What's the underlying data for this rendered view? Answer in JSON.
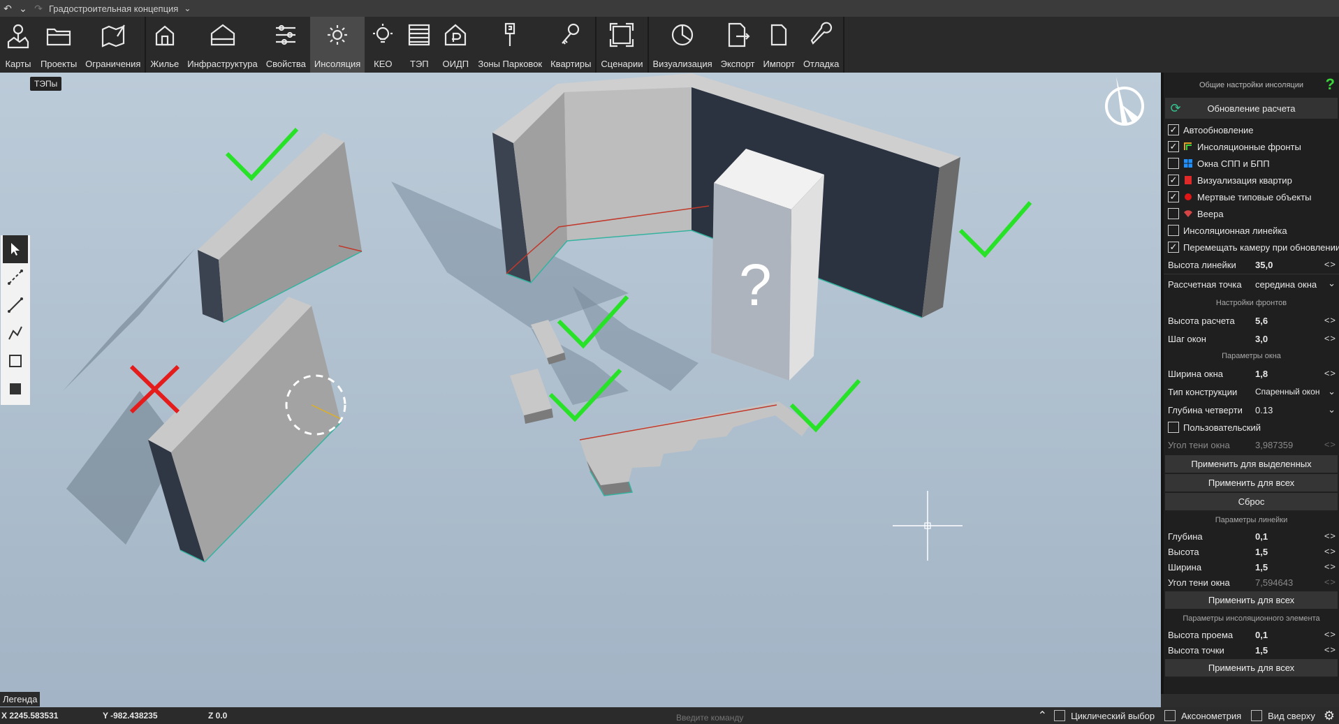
{
  "titlebar": {
    "document": "Градостроительная концепция"
  },
  "toolbar": {
    "groups": [
      [
        {
          "label": "Карты",
          "icon": "map-pin-icon"
        },
        {
          "label": "Проекты",
          "icon": "folder-icon"
        },
        {
          "label": "Ограничения",
          "icon": "map-edit-icon"
        }
      ],
      [
        {
          "label": "Жилье",
          "icon": "house-icon"
        },
        {
          "label": "Инфраструктура",
          "icon": "infrastructure-icon"
        },
        {
          "label": "Свойства",
          "icon": "sliders-icon"
        },
        {
          "label": "Инсоляция",
          "icon": "sun-icon",
          "active": true
        },
        {
          "label": "КЕО",
          "icon": "light-bulb-icon"
        },
        {
          "label": "ТЭП",
          "icon": "table-icon"
        },
        {
          "label": "ОИДП",
          "icon": "ruble-house-icon"
        },
        {
          "label": "Зоны Парковок",
          "icon": "parking-icon"
        },
        {
          "label": "Квартиры",
          "icon": "keys-icon"
        }
      ],
      [
        {
          "label": "Сценарии",
          "icon": "frame-icon"
        }
      ],
      [
        {
          "label": "Визуализация",
          "icon": "pie-icon"
        },
        {
          "label": "Экспорт",
          "icon": "export-icon"
        },
        {
          "label": "Импорт",
          "icon": "file-icon"
        },
        {
          "label": "Отладка",
          "icon": "wrench-icon"
        }
      ]
    ]
  },
  "viewport": {
    "tep_tag": "ТЭПы",
    "question_mark": "?",
    "legend": "Легенда"
  },
  "panel": {
    "header": "Общие настройки инсоляции",
    "help": "?",
    "update_button": "Обновление расчета",
    "checkboxes": [
      {
        "label": "Автообновление",
        "checked": true,
        "icon": ""
      },
      {
        "label": "Инсоляционные фронты",
        "checked": true,
        "icon": "fronts-icon"
      },
      {
        "label": "Окна СПП и БПП",
        "checked": false,
        "icon": "windows-icon"
      },
      {
        "label": "Визуализация квартир",
        "checked": true,
        "icon": "flag-icon"
      },
      {
        "label": "Мертвые типовые объекты",
        "checked": true,
        "icon": "red-dot-icon"
      },
      {
        "label": "Веера",
        "checked": false,
        "icon": "fan-icon"
      },
      {
        "label": "Инсоляционная линейка",
        "checked": false,
        "icon": ""
      },
      {
        "label": "Перемещать камеру при обновлении",
        "checked": true,
        "icon": ""
      }
    ],
    "ruler_height": {
      "label": "Высота линейки",
      "value": "35,0"
    },
    "calc_point": {
      "label": "Рассчетная точка",
      "value": "середина окна"
    },
    "fronts_section": "Настройки фронтов",
    "calc_height": {
      "label": "Высота расчета",
      "value": "5,6"
    },
    "window_step": {
      "label": "Шаг окон",
      "value": "3,0"
    },
    "window_section": "Параметры окна",
    "window_width": {
      "label": "Ширина окна",
      "value": "1,8"
    },
    "construction": {
      "label": "Тип конструкции",
      "value": "Спаренный окон"
    },
    "quarter_depth": {
      "label": "Глубина четверти",
      "value": "0.13"
    },
    "custom": {
      "label": "Пользовательский",
      "checked": false
    },
    "shadow_angle": {
      "label": "Угол тени окна",
      "value": "3,987359"
    },
    "apply_selected": "Применить для выделенных",
    "apply_all": "Применить для всех",
    "reset": "Сброс",
    "ruler_section": "Параметры линейки",
    "r_depth": {
      "label": "Глубина",
      "value": "0,1"
    },
    "r_height": {
      "label": "Высота",
      "value": "1,5"
    },
    "r_width": {
      "label": "Ширина",
      "value": "1,5"
    },
    "r_shadow": {
      "label": "Угол тени окна",
      "value": "7,594643"
    },
    "apply_all_2": "Применить для всех",
    "element_section": "Параметры инсоляционного элемента",
    "opening_height": {
      "label": "Высота проема",
      "value": "0,1"
    },
    "point_height": {
      "label": "Высота точки",
      "value": "1,5"
    },
    "apply_all_3": "Применить для всех"
  },
  "status": {
    "x": "X 2245.583531",
    "y": "Y -982.438235",
    "z": "Z 0.0",
    "command_placeholder": "Введите команду",
    "cyclic": "Циклический выбор",
    "axonometry": "Аксонометрия",
    "top_view": "Вид сверху"
  },
  "colors": {
    "accent_green": "#27e227",
    "error_red": "#e51c1c",
    "teal_front": "#35b3a0",
    "red_front": "#c0392b"
  }
}
